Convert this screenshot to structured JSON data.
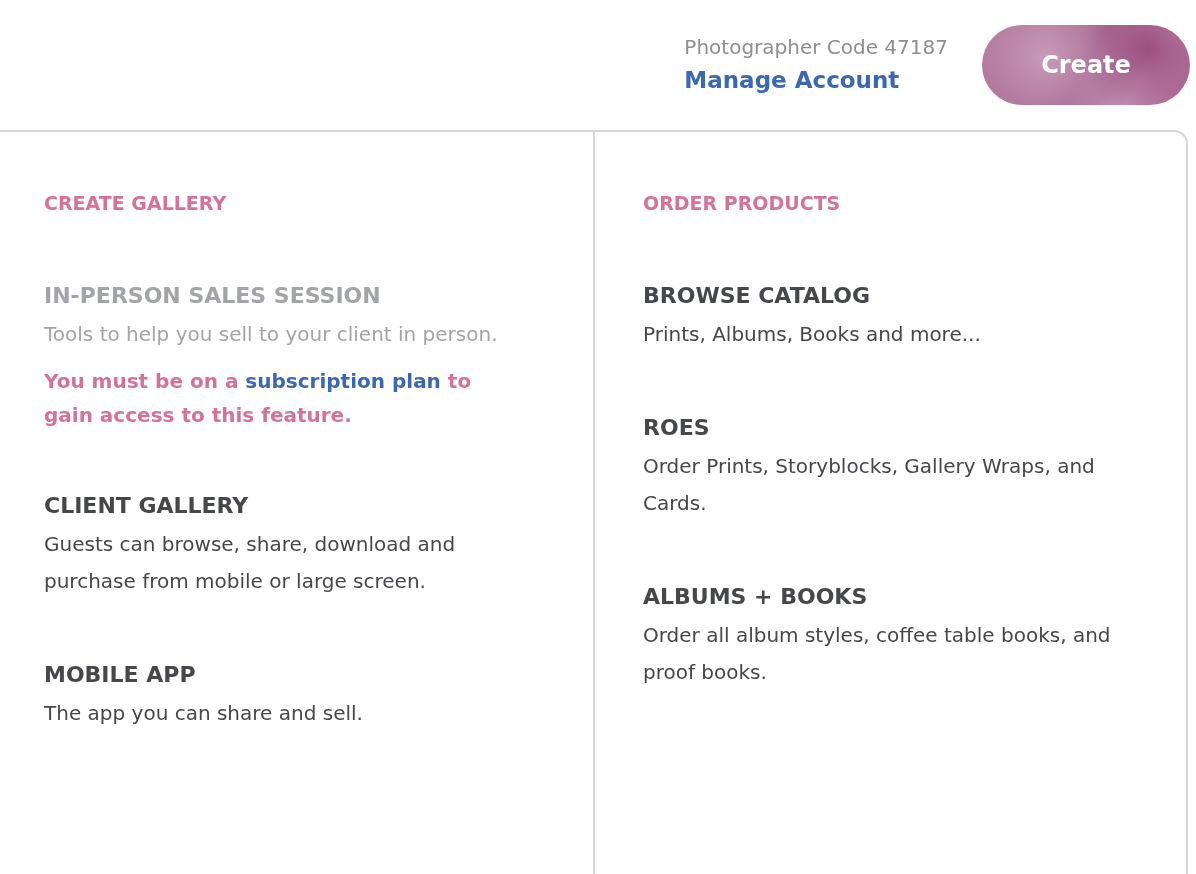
{
  "header": {
    "photographer_code": "Photographer Code 47187",
    "manage_link": "Manage Account",
    "create_button": "Create"
  },
  "menu": {
    "columns": [
      {
        "heading": "CREATE GALLERY",
        "items": [
          {
            "title": "IN-PERSON SALES SESSION",
            "description": "Tools to help you sell to your client in person.",
            "disabled": true,
            "notice": {
              "before": "You must be on a",
              "link": "subscription plan",
              "after": "to gain access to this feature."
            }
          },
          {
            "title": "CLIENT GALLERY",
            "description": "Guests can browse, share, download and purchase from mobile or large screen.",
            "disabled": false
          },
          {
            "title": "MOBILE APP",
            "description": "The app you can share and sell.",
            "disabled": false
          }
        ]
      },
      {
        "heading": "ORDER PRODUCTS",
        "items": [
          {
            "title": "BROWSE CATALOG",
            "description": "Prints, Albums, Books and more...",
            "disabled": false
          },
          {
            "title": "ROES",
            "description": "Order Prints, Storyblocks, Gallery Wraps, and Cards.",
            "disabled": false
          },
          {
            "title": "ALBUMS + BOOKS",
            "description": "Order all album styles, coffee table books, and proof books.",
            "disabled": false
          }
        ]
      }
    ]
  }
}
